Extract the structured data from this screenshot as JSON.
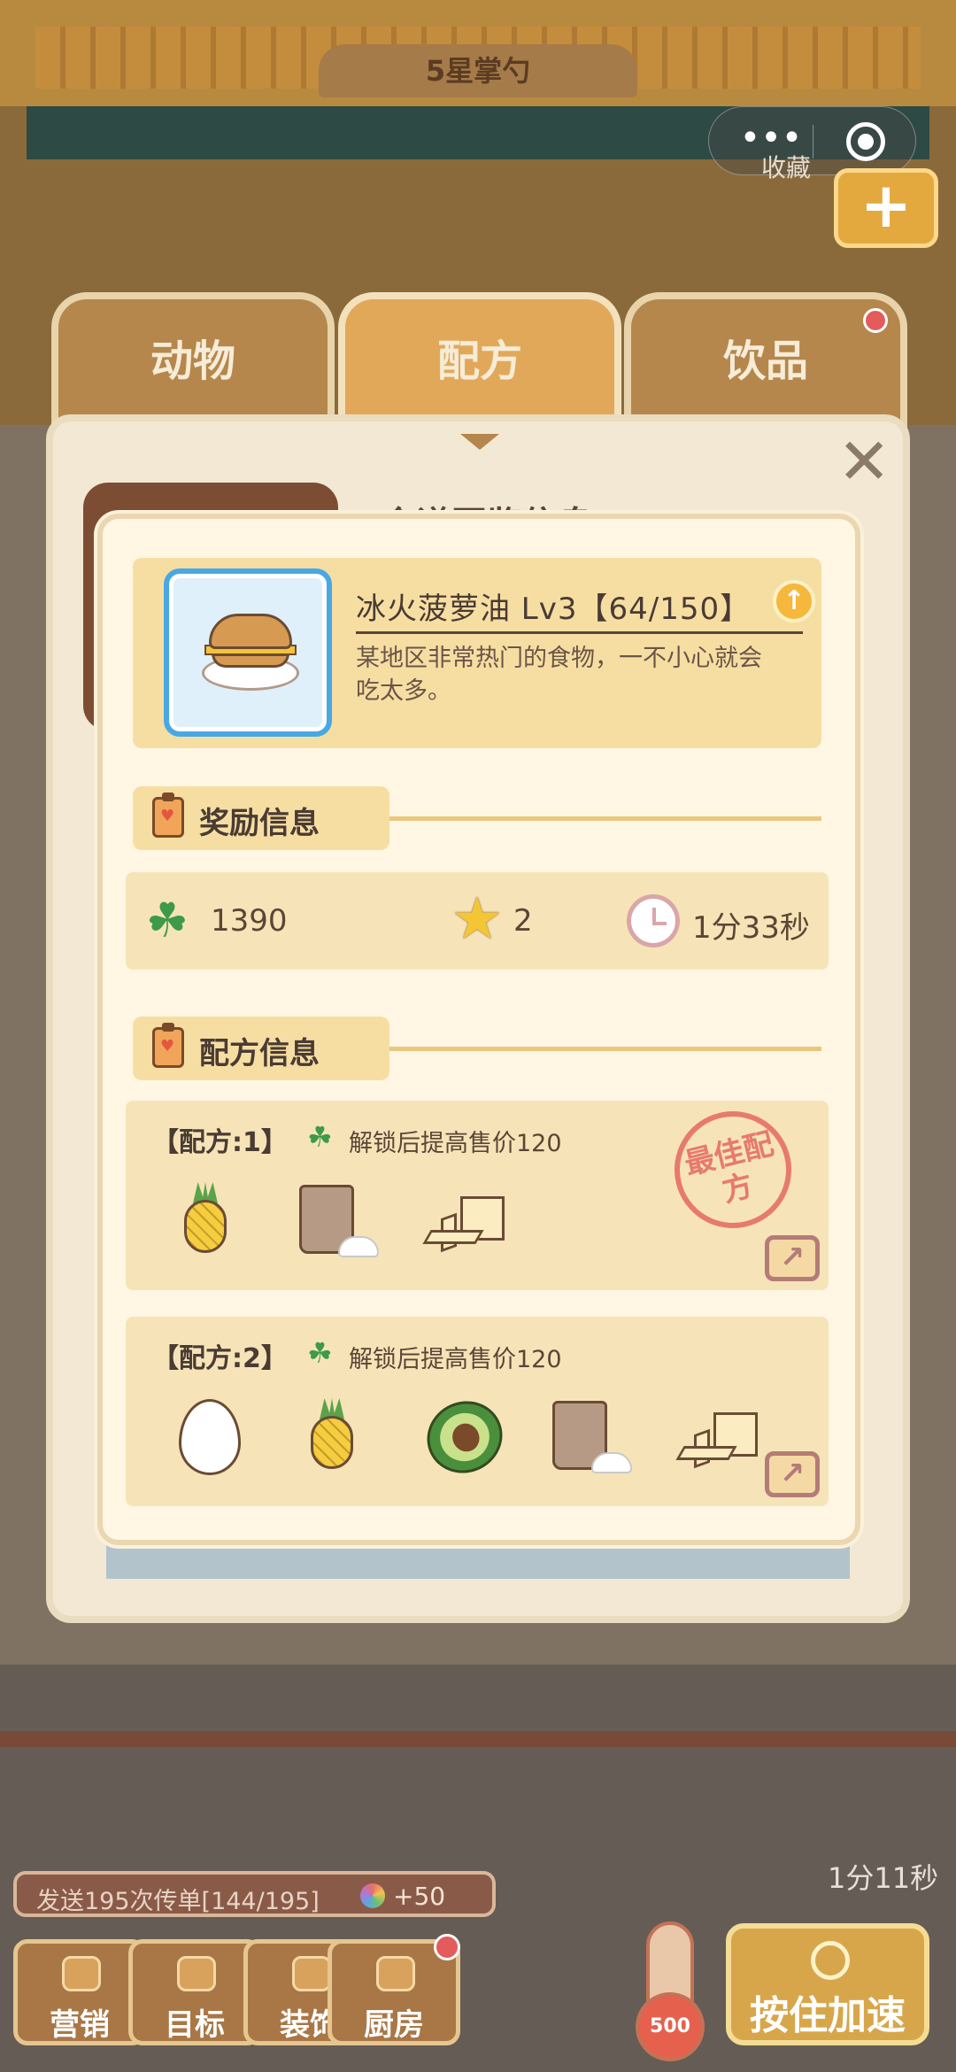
{
  "shop": {
    "sign": "5星掌勺",
    "collect_label": "收藏"
  },
  "miniprogram": {
    "more_dots": "•••"
  },
  "tabs": [
    {
      "label": "动物"
    },
    {
      "label": "配方"
    },
    {
      "label": "饮品"
    }
  ],
  "panel": {
    "heading": "食谱图鉴信息"
  },
  "food": {
    "name_line": "冰火菠萝油 Lv3【64/150】",
    "description": "某地区非常热门的食物，一不小心就会吃太多。"
  },
  "reward_section": {
    "title": "奖励信息",
    "clover_value": "1390",
    "star_value": "2",
    "time_value": "1分33秒"
  },
  "recipe_section": {
    "title": "配方信息",
    "recipes": [
      {
        "title": "【配方:1】",
        "bonus": "解锁后提高售价120",
        "stamp": "最佳配方",
        "ingredients": [
          "pineapple",
          "flour",
          "butter"
        ]
      },
      {
        "title": "【配方:2】",
        "bonus": "解锁后提高售价120",
        "ingredients": [
          "egg",
          "pineapple",
          "avocado",
          "flour",
          "butter"
        ]
      }
    ]
  },
  "quest": {
    "text": "发送195次传单[144/195]",
    "reward": "+50"
  },
  "timer": "1分11秒",
  "bottom_bar": {
    "marketing": "营销",
    "goal": "目标",
    "decor": "装饰",
    "kitchen": "厨房",
    "thermo_value": "500",
    "speed_up": "按住加速"
  },
  "colors": {
    "tab_active": "#e2a85a",
    "tab_inactive": "#b5874c",
    "modal_bg": "#fff7e4",
    "card_bg": "#f6e4b8",
    "frame_blue": "#48a8e4",
    "stamp_red": "#e77a6e",
    "clover_green": "#3e9a48"
  }
}
